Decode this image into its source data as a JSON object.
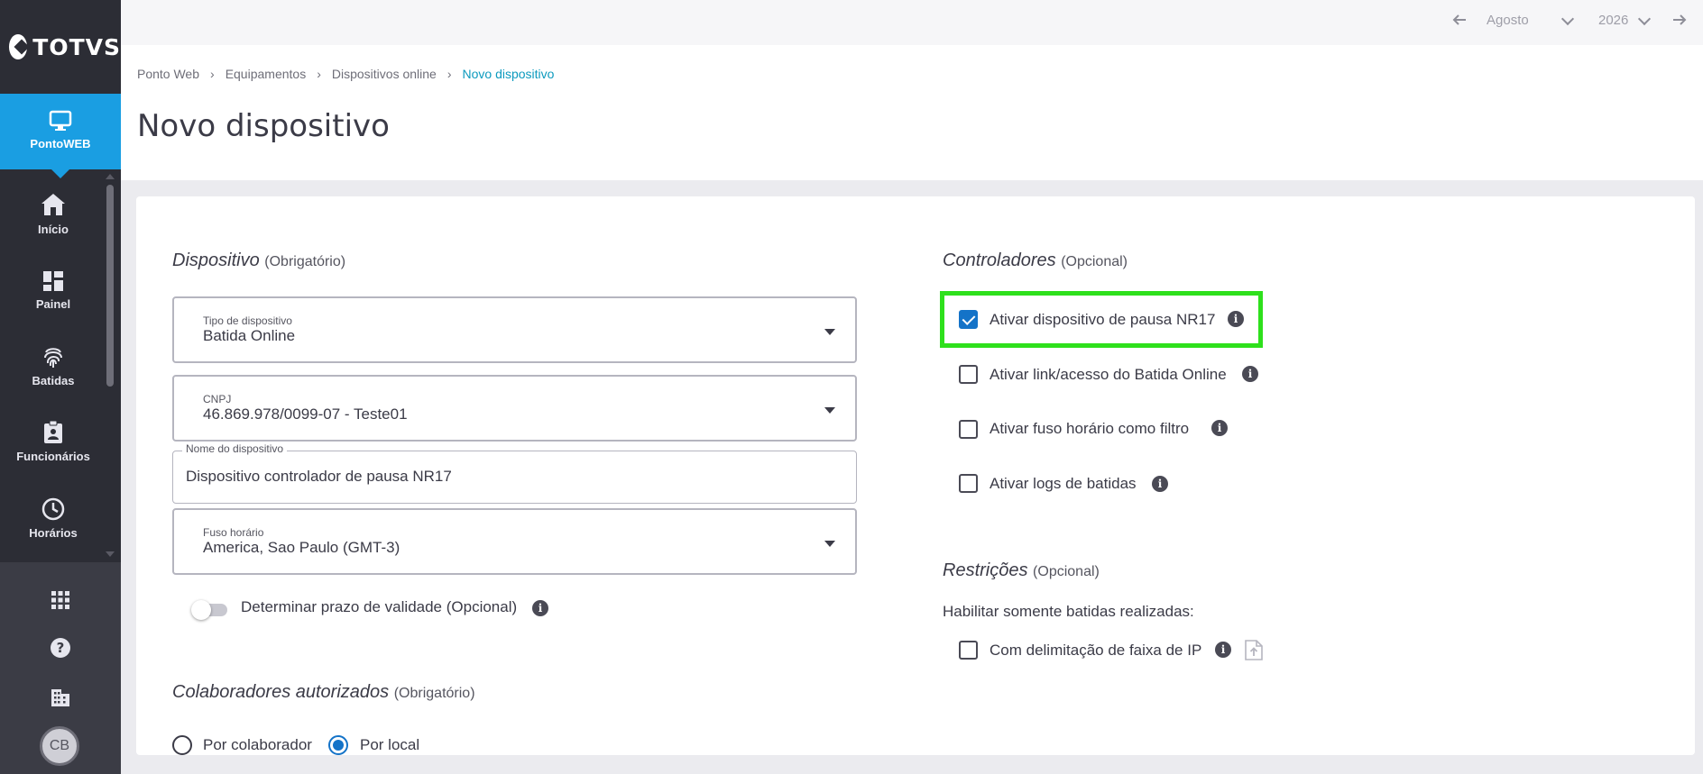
{
  "sidebar": {
    "logo": "TOTVS",
    "active_item": {
      "label": "PontoWEB",
      "icon": "monitor-icon"
    },
    "items": [
      {
        "label": "Início",
        "icon": "home-icon"
      },
      {
        "label": "Painel",
        "icon": "dashboard-icon"
      },
      {
        "label": "Batidas",
        "icon": "fingerprint-icon"
      },
      {
        "label": "Funcionários",
        "icon": "badge-icon"
      },
      {
        "label": "Horários",
        "icon": "clock-icon"
      }
    ],
    "bottom_icons": [
      "apps-grid-icon",
      "help-icon",
      "building-icon"
    ],
    "avatar_initials": "CB"
  },
  "topbar": {
    "month": "Agosto",
    "year": "2026"
  },
  "breadcrumb": [
    "Ponto Web",
    "Equipamentos",
    "Dispositivos online",
    "Novo dispositivo"
  ],
  "page_title": "Novo dispositivo",
  "dispositivo": {
    "title": "Dispositivo",
    "subtitle": "(Obrigatório)",
    "tipo": {
      "label": "Tipo de dispositivo",
      "value": "Batida Online"
    },
    "cnpj": {
      "label": "CNPJ",
      "value": "46.869.978/0099-07 - Teste01"
    },
    "nome": {
      "label": "Nome do dispositivo",
      "value": "Dispositivo controlador de pausa NR17"
    },
    "fuso": {
      "label": "Fuso horário",
      "value": "America, Sao Paulo (GMT-3)"
    },
    "validade_toggle": {
      "label": "Determinar prazo de validade (Opcional)",
      "on": false
    }
  },
  "colaboradores": {
    "title": "Colaboradores autorizados",
    "subtitle": "(Obrigatório)",
    "options": [
      {
        "label": "Por colaborador",
        "selected": false
      },
      {
        "label": "Por local",
        "selected": true
      }
    ]
  },
  "controladores": {
    "title": "Controladores",
    "subtitle": "(Opcional)",
    "options": [
      {
        "label": "Ativar dispositivo de pausa NR17",
        "checked": true
      },
      {
        "label": "Ativar link/acesso do Batida Online",
        "checked": false
      },
      {
        "label": "Ativar fuso horário como filtro",
        "checked": false
      },
      {
        "label": "Ativar logs de batidas",
        "checked": false
      }
    ]
  },
  "restricoes": {
    "title": "Restrições",
    "subtitle": "(Opcional)",
    "description": "Habilitar somente batidas realizadas:",
    "options": [
      {
        "label": "Com delimitação de faixa de IP",
        "checked": false
      }
    ]
  },
  "colors": {
    "accent": "#1a9ee2",
    "checkbox": "#1473c8",
    "highlight": "#2ee01c",
    "sidebar": "#2c2d35"
  }
}
